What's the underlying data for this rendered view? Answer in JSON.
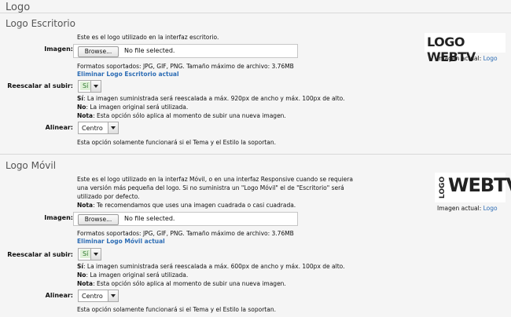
{
  "page_title": "Logo",
  "sections": [
    {
      "heading": "Logo Escritorio",
      "description": "Este es el logo utilizado en la interfaz escritorio.",
      "image_label": "Imagen:",
      "browse_label": "Browse...",
      "file_status": "No file selected.",
      "formats": "Formatos soportados: JPG, GIF, PNG. Tamaño máximo de archivo: 3.76MB",
      "delete_link": "Eliminar Logo Escritorio actual",
      "rescale_label": "Reescalar al subir:",
      "rescale_value": "Sí",
      "rescale_yes_prefix": "Sí",
      "rescale_yes_text": ": La imagen suministrada será reescalada a máx. 920px de ancho y máx. 100px de alto.",
      "rescale_no_prefix": "No",
      "rescale_no_text": ": La imagen original será utilizada.",
      "rescale_note_prefix": "Nota",
      "rescale_note_text": ": Esta opción sólo aplica al momento de subir una nueva imagen.",
      "align_label": "Alinear:",
      "align_value": "Centro",
      "align_note": "Esta opción solamente funcionará si el Tema y el Estilo la soportan.",
      "logo_text": "LOGO WEBTV",
      "current_image_label": "Imagen actual: ",
      "current_image_link": "Logo"
    },
    {
      "heading": "Logo Móvil",
      "description_lines": [
        "Este es el logo utilizado en la interfaz Móvil, o en una interfaz Responsive cuando se requiera",
        "una versión más pequeña del logo. Si no suministra un \"Logo Móvil\" el de \"Escritorio\" será",
        "utilizado por defecto."
      ],
      "note_prefix": "Nota",
      "note_text": ": Te recomendamos que uses una imagen cuadrada o casi cuadrada.",
      "image_label": "Imagen:",
      "browse_label": "Browse...",
      "file_status": "No file selected.",
      "formats": "Formatos soportados: JPG, GIF, PNG. Tamaño máximo de archivo: 3.76MB",
      "delete_link": "Eliminar Logo Móvil actual",
      "rescale_label": "Reescalar al subir:",
      "rescale_value": "Sí",
      "rescale_yes_prefix": "Sí",
      "rescale_yes_text": ": La imagen suministrada será reescalada a máx. 600px de ancho y máx. 100px de alto.",
      "rescale_no_prefix": "No",
      "rescale_no_text": ": La imagen original será utilizada.",
      "rescale_note_prefix": "Nota",
      "rescale_note_text": ": Esta opción sólo aplica al momento de subir una nueva imagen.",
      "align_label": "Alinear:",
      "align_value": "Centro",
      "align_note": "Esta opción solamente funcionará si el Tema y el Estilo la soportan.",
      "logo_vertical": "LOGO",
      "logo_main": "WEBTV",
      "current_image_label": "Imagen actual: ",
      "current_image_link": "Logo"
    }
  ],
  "colors": {
    "link": "#2d6db5",
    "background": "#f5f5f5",
    "yes_bg": "#dff0d8",
    "yes_text": "#2f7a2f"
  }
}
